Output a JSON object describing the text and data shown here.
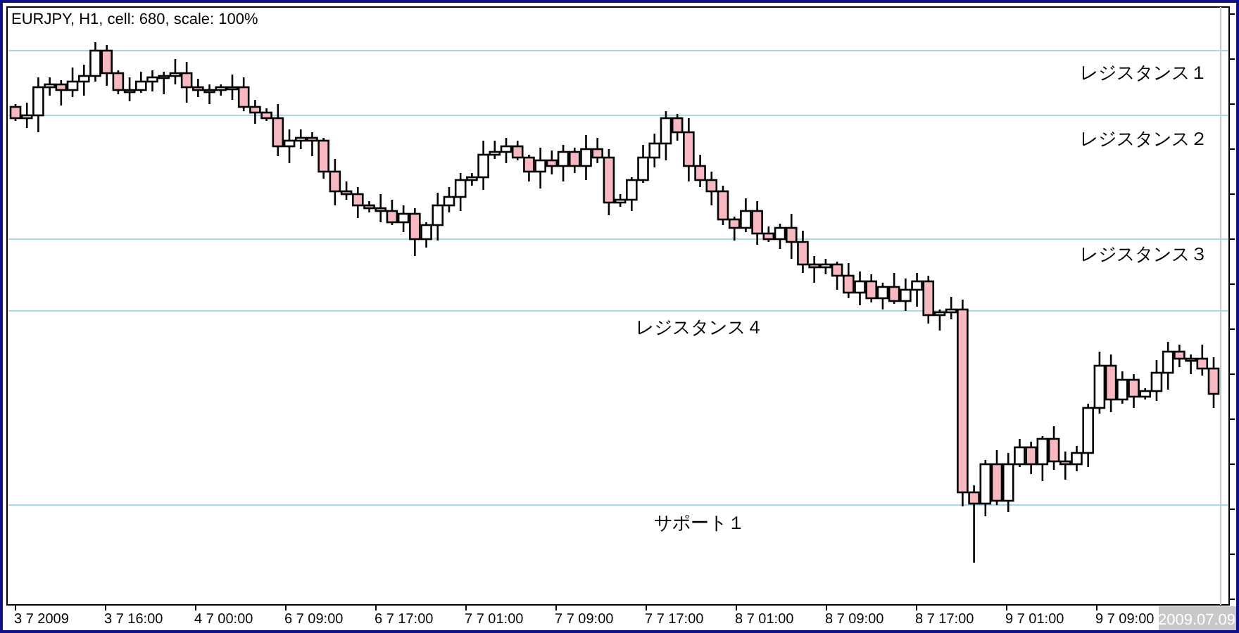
{
  "title": "EURJPY, H1, cell: 680, scale: 100%",
  "levels": [
    {
      "label": "レジスタンス１"
    },
    {
      "label": "レジスタンス２"
    },
    {
      "label": "レジスタンス３"
    },
    {
      "label": "レジスタンス４"
    },
    {
      "label": "サポート１"
    }
  ],
  "time_axis": [
    "3 7 2009",
    "3 7 16:00",
    "4 7 00:00",
    "6 7 09:00",
    "6 7 17:00",
    "7 7 01:00",
    "7 7 09:00",
    "7 7 17:00",
    "8 7 01:00",
    "8 7 09:00",
    "8 7 17:00",
    "9 7 01:00",
    "9 7 09:00"
  ],
  "date_badge": "2009.07.09"
}
